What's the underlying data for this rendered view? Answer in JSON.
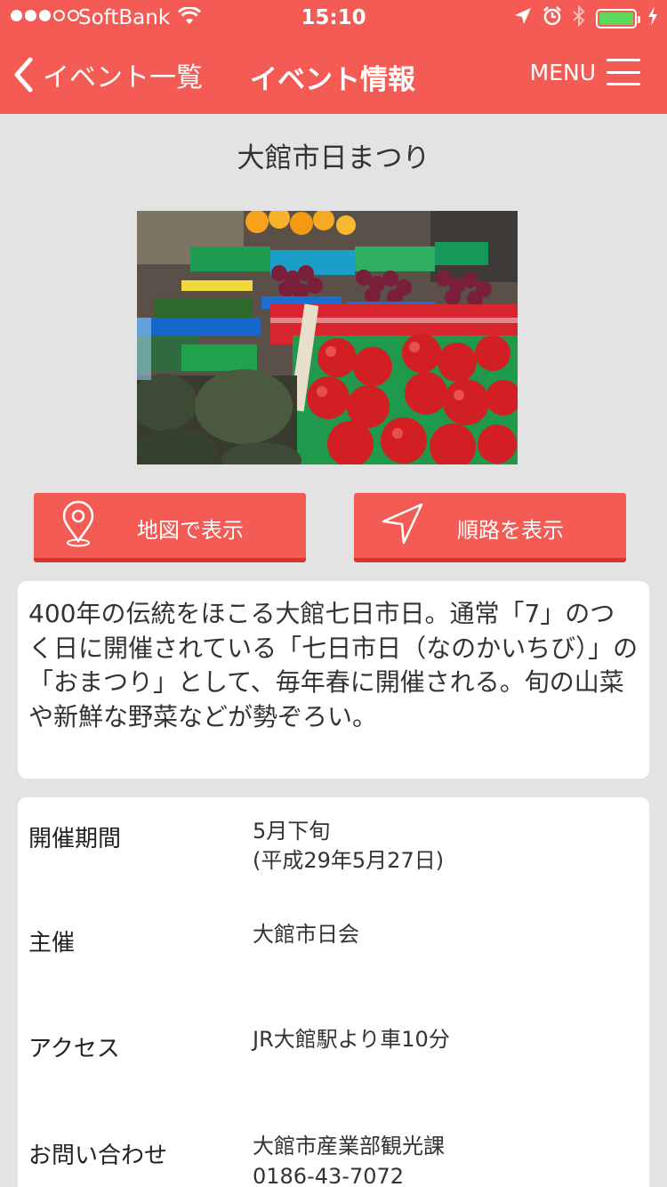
{
  "status": {
    "carrier": "SoftBank",
    "time": "15:10",
    "battery_level": 1.0,
    "battery_color": "#5cd85a"
  },
  "nav": {
    "back_label": "イベント一覧",
    "title": "イベント情報",
    "menu_label": "MENU",
    "bar_color": "#f45b55"
  },
  "event": {
    "title": "大館市日まつり",
    "description": "400年の伝統をほこる大館七日市日。通常「7」のつく日に開催されている「七日市日（なのかいちび）」の「おまつり」として、毎年春に開催される。旬の山菜や新鮮な野菜などが勢ぞろい。"
  },
  "buttons": {
    "map_label": "地図で表示",
    "route_label": "順路を表示"
  },
  "info": {
    "period_label": "開催期間",
    "period_value": "5月下旬",
    "period_detail": "(平成29年5月27日)",
    "organizer_label": "主催",
    "organizer_value": "大館市日会",
    "access_label": "アクセス",
    "access_value": "JR大館駅より車10分",
    "contact_label": "お問い合わせ",
    "contact_value": "大館市産業部観光課",
    "contact_phone": "0186-43-7072"
  }
}
